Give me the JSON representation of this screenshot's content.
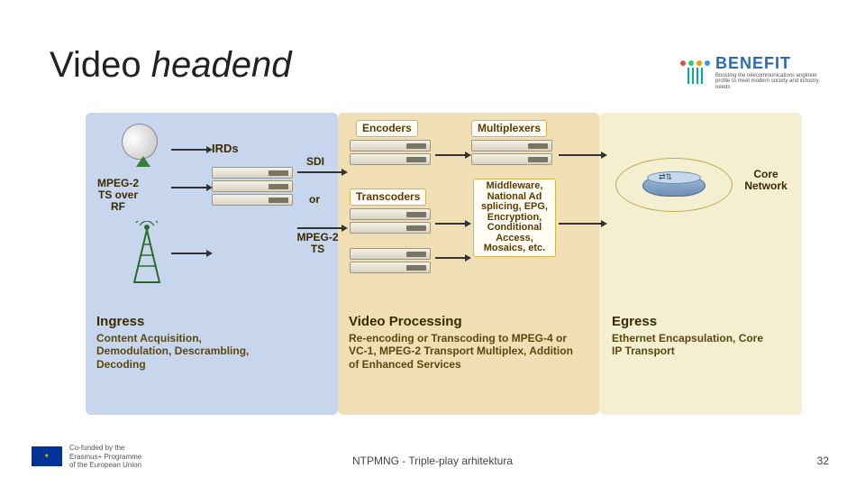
{
  "title": {
    "word1": "Video",
    "word2": "headend"
  },
  "logo": {
    "brand": "BENEFIT",
    "tagline": "Boosting the telecommunications engineer profile to meet modern society and industry needs",
    "dot_colors": [
      "#e74c3c",
      "#2ecc71",
      "#f39c12",
      "#3498db"
    ]
  },
  "columns": {
    "ingress": {
      "title": "Ingress",
      "subtitle": "Content Acquisition, Demodulation, Descrambling, Decoding"
    },
    "processing": {
      "title": "Video Processing",
      "subtitle": "Re-encoding or Transcoding to MPEG-4 or VC-1, MPEG-2 Transport Multiplex, Addition of Enhanced Services"
    },
    "egress": {
      "title": "Egress",
      "subtitle": "Ethernet Encapsulation, Core IP Transport"
    }
  },
  "labels": {
    "irds": "IRDs",
    "mpeg2ts_rf": "MPEG-2 TS over RF",
    "sdi": "SDI",
    "or": "or",
    "mpeg2ts": "MPEG-2 TS",
    "encoders": "Encoders",
    "transcoders": "Transcoders",
    "multiplexers": "Multiplexers",
    "middleware": "Middleware, National Ad splicing, EPG, Encryption, Conditional Access, Mosaics, etc.",
    "core_network": "Core Network"
  },
  "eu": {
    "line1": "Co-funded by the",
    "line2": "Erasmus+ Programme",
    "line3": "of the European Union"
  },
  "footer": {
    "center": "NTPMNG - Triple-play arhitektura",
    "page": "32"
  }
}
